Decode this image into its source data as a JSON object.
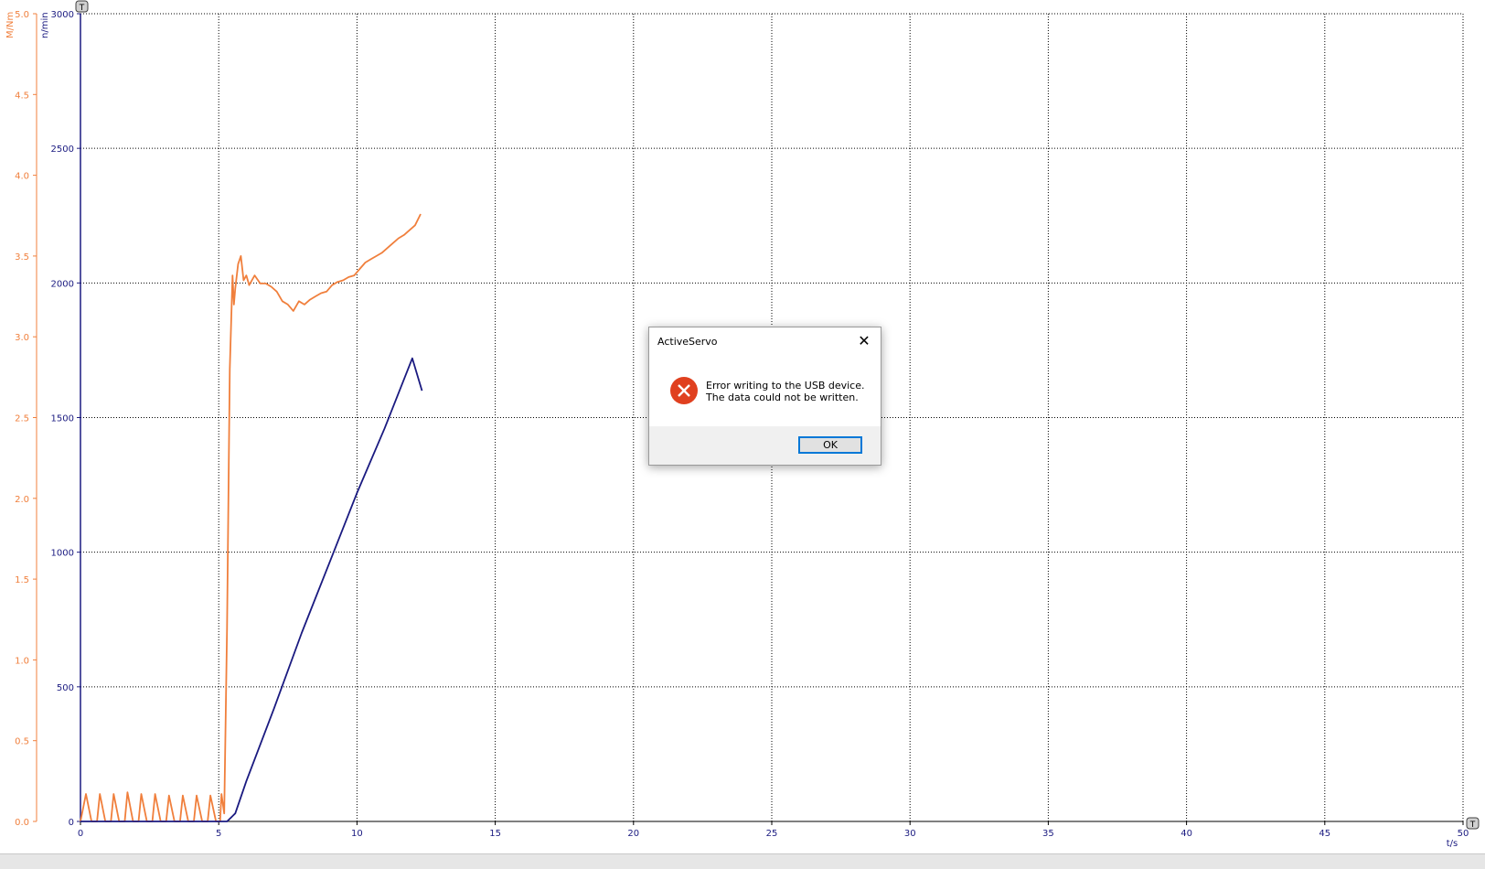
{
  "chart_data": {
    "type": "line",
    "x_axis": {
      "label": "t/s",
      "range": [
        0,
        50
      ],
      "ticks": [
        "0",
        "5",
        "10",
        "15",
        "20",
        "25",
        "30",
        "35",
        "40",
        "45",
        "50"
      ]
    },
    "y_axis_left": {
      "label": "M/Nm",
      "range": [
        0,
        5.0
      ],
      "ticks": [
        "0.0",
        "0.5",
        "1.0",
        "1.5",
        "2.0",
        "2.5",
        "3.0",
        "3.5",
        "4.0",
        "4.5",
        "5.0"
      ],
      "color": "#f07f3c"
    },
    "y_axis_right": {
      "label": "n/min",
      "range": [
        0,
        3000
      ],
      "ticks": [
        "0",
        "500",
        "1000",
        "1500",
        "2000",
        "2500",
        "3000"
      ],
      "color": "#1a1a80"
    },
    "grid": true,
    "series": [
      {
        "name": "M/Nm",
        "axis": "left",
        "color": "#f07f3c",
        "points": [
          [
            0,
            0
          ],
          [
            0.2,
            0.17
          ],
          [
            0.4,
            0
          ],
          [
            0.6,
            0
          ],
          [
            0.7,
            0.17
          ],
          [
            0.9,
            0
          ],
          [
            1.1,
            0
          ],
          [
            1.2,
            0.17
          ],
          [
            1.4,
            0
          ],
          [
            1.6,
            0
          ],
          [
            1.7,
            0.18
          ],
          [
            1.9,
            0
          ],
          [
            2.1,
            0
          ],
          [
            2.2,
            0.17
          ],
          [
            2.4,
            0
          ],
          [
            2.6,
            0
          ],
          [
            2.7,
            0.17
          ],
          [
            2.9,
            0
          ],
          [
            3.1,
            0
          ],
          [
            3.2,
            0.16
          ],
          [
            3.4,
            0
          ],
          [
            3.6,
            0
          ],
          [
            3.7,
            0.16
          ],
          [
            3.9,
            0
          ],
          [
            4.1,
            0
          ],
          [
            4.2,
            0.16
          ],
          [
            4.4,
            0
          ],
          [
            4.6,
            0
          ],
          [
            4.7,
            0.16
          ],
          [
            4.9,
            0
          ],
          [
            5.05,
            0
          ],
          [
            5.1,
            0.17
          ],
          [
            5.2,
            0.05
          ],
          [
            5.3,
            1.2
          ],
          [
            5.4,
            2.8
          ],
          [
            5.5,
            3.38
          ],
          [
            5.55,
            3.2
          ],
          [
            5.6,
            3.3
          ],
          [
            5.7,
            3.45
          ],
          [
            5.8,
            3.5
          ],
          [
            5.9,
            3.35
          ],
          [
            6.0,
            3.38
          ],
          [
            6.1,
            3.32
          ],
          [
            6.3,
            3.38
          ],
          [
            6.5,
            3.33
          ],
          [
            6.7,
            3.33
          ],
          [
            6.9,
            3.31
          ],
          [
            7.1,
            3.28
          ],
          [
            7.3,
            3.22
          ],
          [
            7.5,
            3.2
          ],
          [
            7.7,
            3.16
          ],
          [
            7.9,
            3.22
          ],
          [
            8.1,
            3.2
          ],
          [
            8.3,
            3.23
          ],
          [
            8.5,
            3.25
          ],
          [
            8.7,
            3.27
          ],
          [
            8.9,
            3.28
          ],
          [
            9.1,
            3.32
          ],
          [
            9.3,
            3.34
          ],
          [
            9.5,
            3.35
          ],
          [
            9.7,
            3.37
          ],
          [
            9.9,
            3.38
          ],
          [
            10.1,
            3.42
          ],
          [
            10.3,
            3.46
          ],
          [
            10.5,
            3.48
          ],
          [
            10.7,
            3.5
          ],
          [
            10.9,
            3.52
          ],
          [
            11.1,
            3.55
          ],
          [
            11.3,
            3.58
          ],
          [
            11.5,
            3.61
          ],
          [
            11.7,
            3.63
          ],
          [
            11.9,
            3.66
          ],
          [
            12.1,
            3.69
          ],
          [
            12.3,
            3.76
          ]
        ]
      },
      {
        "name": "n/min",
        "axis": "right",
        "color": "#1a1a80",
        "points": [
          [
            0,
            0
          ],
          [
            5.3,
            0
          ],
          [
            5.6,
            30
          ],
          [
            6.0,
            150
          ],
          [
            7.0,
            420
          ],
          [
            8.0,
            700
          ],
          [
            9.0,
            960
          ],
          [
            10.0,
            1220
          ],
          [
            11.0,
            1460
          ],
          [
            12.0,
            1720
          ],
          [
            12.35,
            1600
          ]
        ]
      }
    ]
  },
  "dialog": {
    "title": "ActiveServo",
    "close_glyph": "✕",
    "icon": "error-icon",
    "message_line1": "Error writing to the USB device.",
    "message_line2": "The data could not be written.",
    "ok_label": "OK"
  },
  "markers": {
    "top_axis_marker": "T",
    "right_axis_marker": "T"
  }
}
